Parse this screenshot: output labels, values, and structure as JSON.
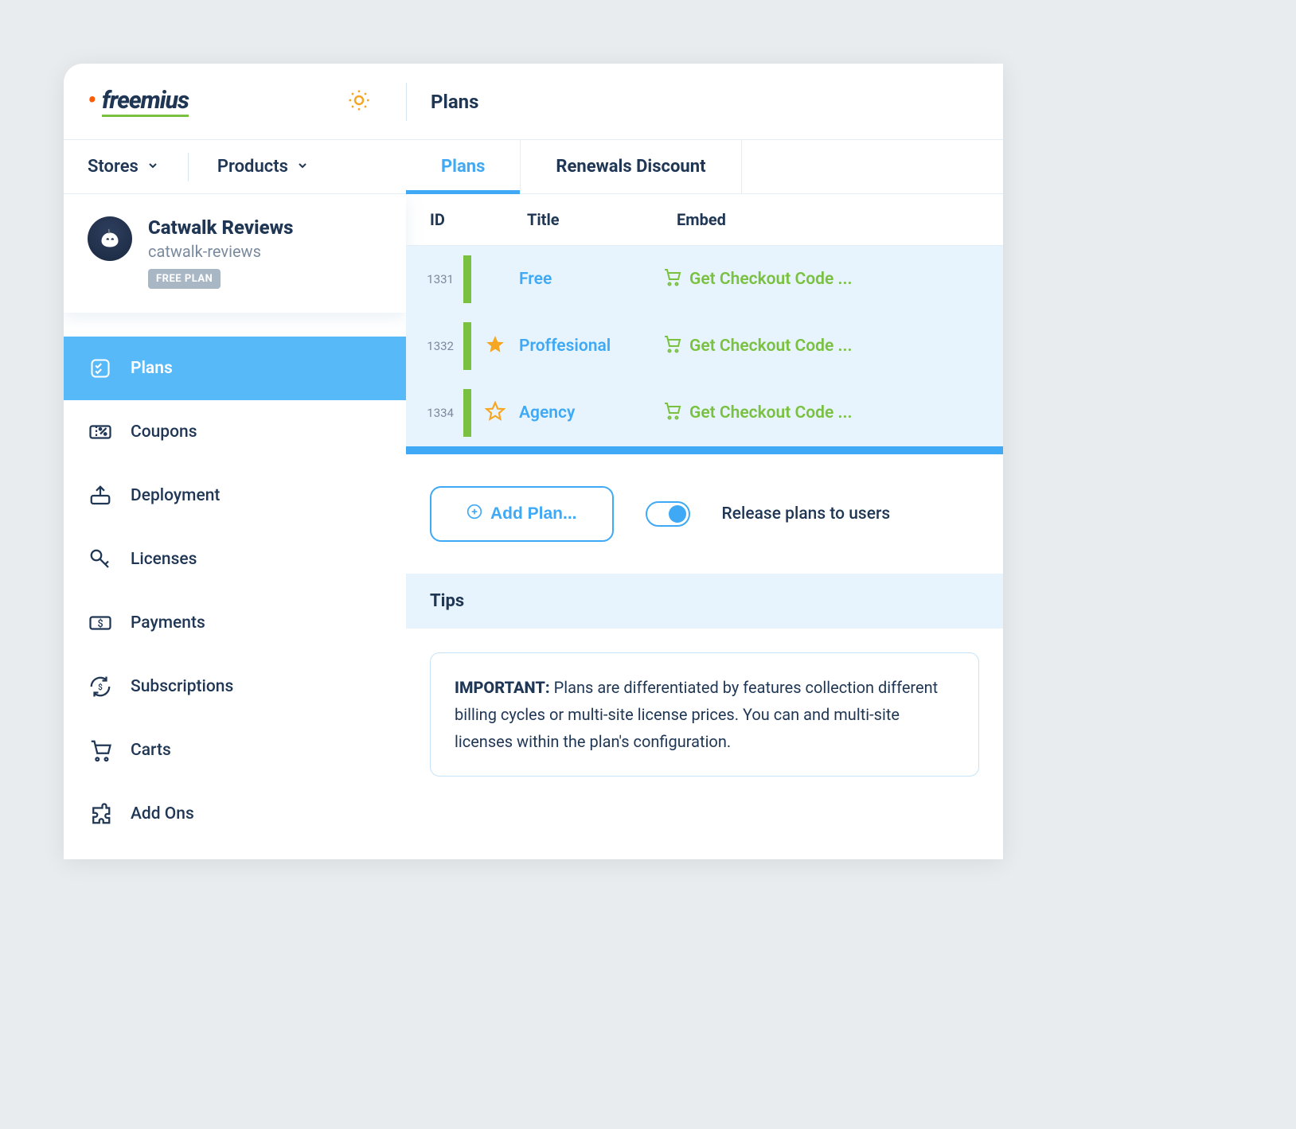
{
  "header": {
    "logo": "freemius",
    "page_title": "Plans"
  },
  "nav": {
    "stores_label": "Stores",
    "products_label": "Products"
  },
  "tabs": [
    {
      "label": "Plans",
      "active": true
    },
    {
      "label": "Renewals Discount",
      "active": false
    }
  ],
  "product": {
    "title": "Catwalk Reviews",
    "slug": "catwalk-reviews",
    "badge": "FREE PLAN"
  },
  "sidebar": {
    "items": [
      {
        "label": "Plans",
        "icon": "checklist"
      },
      {
        "label": "Coupons",
        "icon": "ticket"
      },
      {
        "label": "Deployment",
        "icon": "upload-box"
      },
      {
        "label": "Licenses",
        "icon": "key"
      },
      {
        "label": "Payments",
        "icon": "cash"
      },
      {
        "label": "Subscriptions",
        "icon": "refresh-dollar"
      },
      {
        "label": "Carts",
        "icon": "cart"
      },
      {
        "label": "Add Ons",
        "icon": "puzzle"
      }
    ]
  },
  "table": {
    "columns": {
      "id": "ID",
      "title": "Title",
      "embed": "Embed"
    },
    "rows": [
      {
        "id": "1331",
        "featured": "none",
        "title": "Free",
        "embed": "Get Checkout Code ..."
      },
      {
        "id": "1332",
        "featured": "full",
        "title": "Proffesional",
        "embed": "Get Checkout Code ..."
      },
      {
        "id": "1334",
        "featured": "outline",
        "title": "Agency",
        "embed": "Get Checkout Code ..."
      }
    ]
  },
  "actions": {
    "add_plan": "Add Plan...",
    "release_toggle_label": "Release plans to users"
  },
  "tips": {
    "heading": "Tips",
    "important_label": "IMPORTANT:",
    "body": " Plans are differentiated by features collection different billing cycles or multi-site license prices. You can and multi-site licenses within the plan's configuration."
  },
  "colors": {
    "accent": "#3fa9f5",
    "green": "#7ac142",
    "orange": "#f5a623"
  }
}
